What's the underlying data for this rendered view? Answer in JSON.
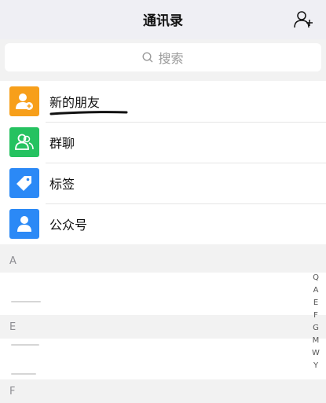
{
  "header": {
    "title": "通讯录"
  },
  "search": {
    "placeholder": "搜索"
  },
  "menu": [
    {
      "label": "新的朋友",
      "color": "#f79f1a"
    },
    {
      "label": "群聊",
      "color": "#25c260"
    },
    {
      "label": "标签",
      "color": "#2b89f6"
    },
    {
      "label": "公众号",
      "color": "#2b89f6"
    }
  ],
  "sections": [
    {
      "letter": "A"
    },
    {
      "letter": "E"
    },
    {
      "letter": "F"
    }
  ],
  "index": [
    "Q",
    "A",
    "E",
    "F",
    "G",
    "M",
    "W",
    "Y"
  ]
}
